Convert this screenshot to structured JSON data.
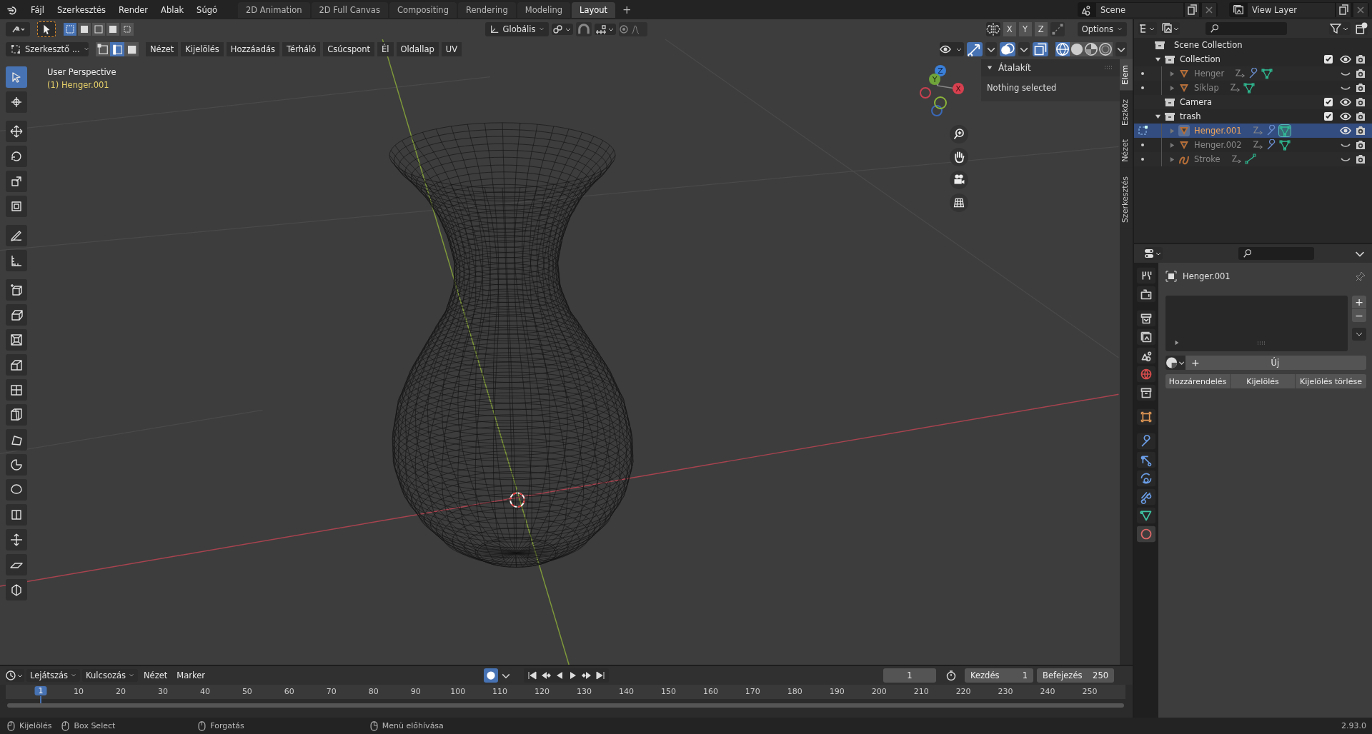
{
  "topbar": {
    "menus": [
      "Fájl",
      "Szerkesztés",
      "Render",
      "Ablak",
      "Súgó"
    ],
    "workspaces": [
      {
        "label": "2D Animation",
        "selected": false
      },
      {
        "label": "2D Full Canvas",
        "selected": false
      },
      {
        "label": "Compositing",
        "selected": false
      },
      {
        "label": "Rendering",
        "selected": false
      },
      {
        "label": "Modeling",
        "selected": false
      },
      {
        "label": "Layout",
        "selected": true
      }
    ],
    "add_tab": "+",
    "scene": "Scene",
    "view_layer": "View Layer"
  },
  "viewport": {
    "header": {
      "orientation": "Globális",
      "proportional_editing": false,
      "axes": [
        "X",
        "Y",
        "Z"
      ],
      "options": "Options",
      "mode": "Szerkesztő ...",
      "select_modes": [
        {
          "kind": "vertex",
          "selected": false
        },
        {
          "kind": "edge",
          "selected": true
        },
        {
          "kind": "face",
          "selected": false
        }
      ],
      "menus": [
        "Nézet",
        "Kijelölés",
        "Hozzáadás",
        "Térháló",
        "Csúcspont",
        "Él",
        "Oldallap",
        "UV"
      ]
    },
    "view_name": "User Perspective",
    "object_name": "(1) Henger.001",
    "gizmo_axes": [
      "Z",
      "Y",
      "X"
    ],
    "n_panel": {
      "section": "Átalakít",
      "message": "Nothing selected",
      "tabs": [
        {
          "label": "Elem",
          "selected": true
        },
        {
          "label": "Eszköz",
          "selected": false
        },
        {
          "label": "Nézet",
          "selected": false
        },
        {
          "label": "Szerkesztés",
          "selected": false
        }
      ]
    }
  },
  "outliner": {
    "root": "Scene Collection",
    "items": [
      {
        "label": "Collection",
        "kind": "collection",
        "expanded": true,
        "enabled": true,
        "visible": true,
        "selected": false,
        "children": [
          {
            "label": "Henger",
            "kind": "mesh",
            "expanded": false,
            "modifier": true,
            "visible": false,
            "selected": false
          },
          {
            "label": "Síklap",
            "kind": "mesh",
            "expanded": false,
            "modifier": false,
            "visible": false,
            "selected": false
          }
        ]
      },
      {
        "label": "Camera",
        "kind": "collection",
        "enabled": true,
        "visible": true,
        "selected": false
      },
      {
        "label": "trash",
        "kind": "collection",
        "expanded": true,
        "enabled": true,
        "visible": true,
        "selected": false,
        "children": [
          {
            "label": "Henger.001",
            "kind": "mesh",
            "expanded": false,
            "modifier": true,
            "visible": true,
            "selected": true
          },
          {
            "label": "Henger.002",
            "kind": "mesh",
            "expanded": false,
            "modifier": true,
            "visible": false,
            "selected": false
          },
          {
            "label": "Stroke",
            "kind": "stroke",
            "expanded": false,
            "modifier": false,
            "visible": false,
            "selected": false
          }
        ]
      }
    ]
  },
  "properties": {
    "tabs": [
      {
        "kind": "tool",
        "selected": false
      },
      {
        "kind": "render",
        "selected": false
      },
      {
        "kind": "output",
        "selected": false
      },
      {
        "kind": "view_layer",
        "selected": false
      },
      {
        "kind": "scene",
        "selected": false
      },
      {
        "kind": "world",
        "selected": false
      },
      {
        "kind": "collection",
        "selected": false
      },
      {
        "kind": "object",
        "selected": false
      },
      {
        "kind": "modifier",
        "selected": false
      },
      {
        "kind": "particles",
        "selected": false
      },
      {
        "kind": "physics",
        "selected": false
      },
      {
        "kind": "constraints",
        "selected": false
      },
      {
        "kind": "data",
        "selected": false
      },
      {
        "kind": "material",
        "selected": true
      }
    ],
    "object": "Henger.001",
    "add": "+",
    "remove": "−",
    "new_plus": "+",
    "new_button": "Új",
    "buttons": [
      "Hozzárendelés",
      "Kijelölés",
      "Kijelölés törlése"
    ]
  },
  "timeline": {
    "menus": [
      "Lejátszás",
      "Kulcsozás",
      "Nézet",
      "Marker"
    ],
    "current_frame": "1",
    "start_label": "Kezdés",
    "start": "1",
    "end_label": "Befejezés",
    "end": "250",
    "playhead": "1",
    "ticks": [
      "10",
      "20",
      "30",
      "40",
      "50",
      "60",
      "70",
      "80",
      "90",
      "100",
      "110",
      "120",
      "130",
      "140",
      "150",
      "160",
      "170",
      "180",
      "190",
      "200",
      "210",
      "220",
      "230",
      "240",
      "250"
    ]
  },
  "status_bar": {
    "items": [
      "Kijelölés",
      "Box Select",
      "Forgatás",
      "Menü előhívása"
    ],
    "version": "2.93.0"
  }
}
